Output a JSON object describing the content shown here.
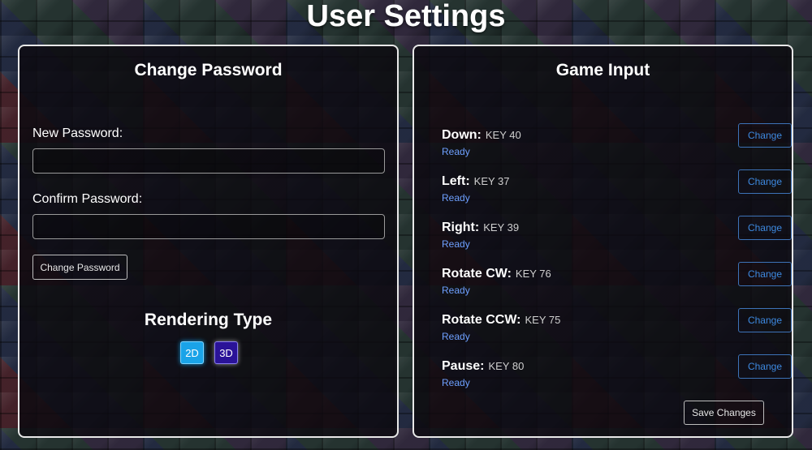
{
  "page": {
    "title": "User Settings"
  },
  "password": {
    "heading": "Change Password",
    "new_label": "New Password:",
    "new_value": "",
    "confirm_label": "Confirm Password:",
    "confirm_value": "",
    "button_label": "Change Password"
  },
  "rendering": {
    "heading": "Rendering Type",
    "options": [
      "2D",
      "3D"
    ]
  },
  "game_input": {
    "heading": "Game Input",
    "bindings": [
      {
        "action": "Down:",
        "key": "KEY 40",
        "status": "Ready",
        "button": "Change"
      },
      {
        "action": "Left:",
        "key": "KEY 37",
        "status": "Ready",
        "button": "Change"
      },
      {
        "action": "Right:",
        "key": "KEY 39",
        "status": "Ready",
        "button": "Change"
      },
      {
        "action": "Rotate CW:",
        "key": "KEY 76",
        "status": "Ready",
        "button": "Change"
      },
      {
        "action": "Rotate CCW:",
        "key": "KEY 75",
        "status": "Ready",
        "button": "Change"
      },
      {
        "action": "Pause:",
        "key": "KEY 80",
        "status": "Ready",
        "button": "Change"
      }
    ],
    "save_label": "Save Changes"
  },
  "colors": {
    "accent_blue": "#3d89e0",
    "status_blue": "#6ea0ff",
    "render_2d": "#1aa3e8",
    "render_3d": "#2a1398"
  }
}
